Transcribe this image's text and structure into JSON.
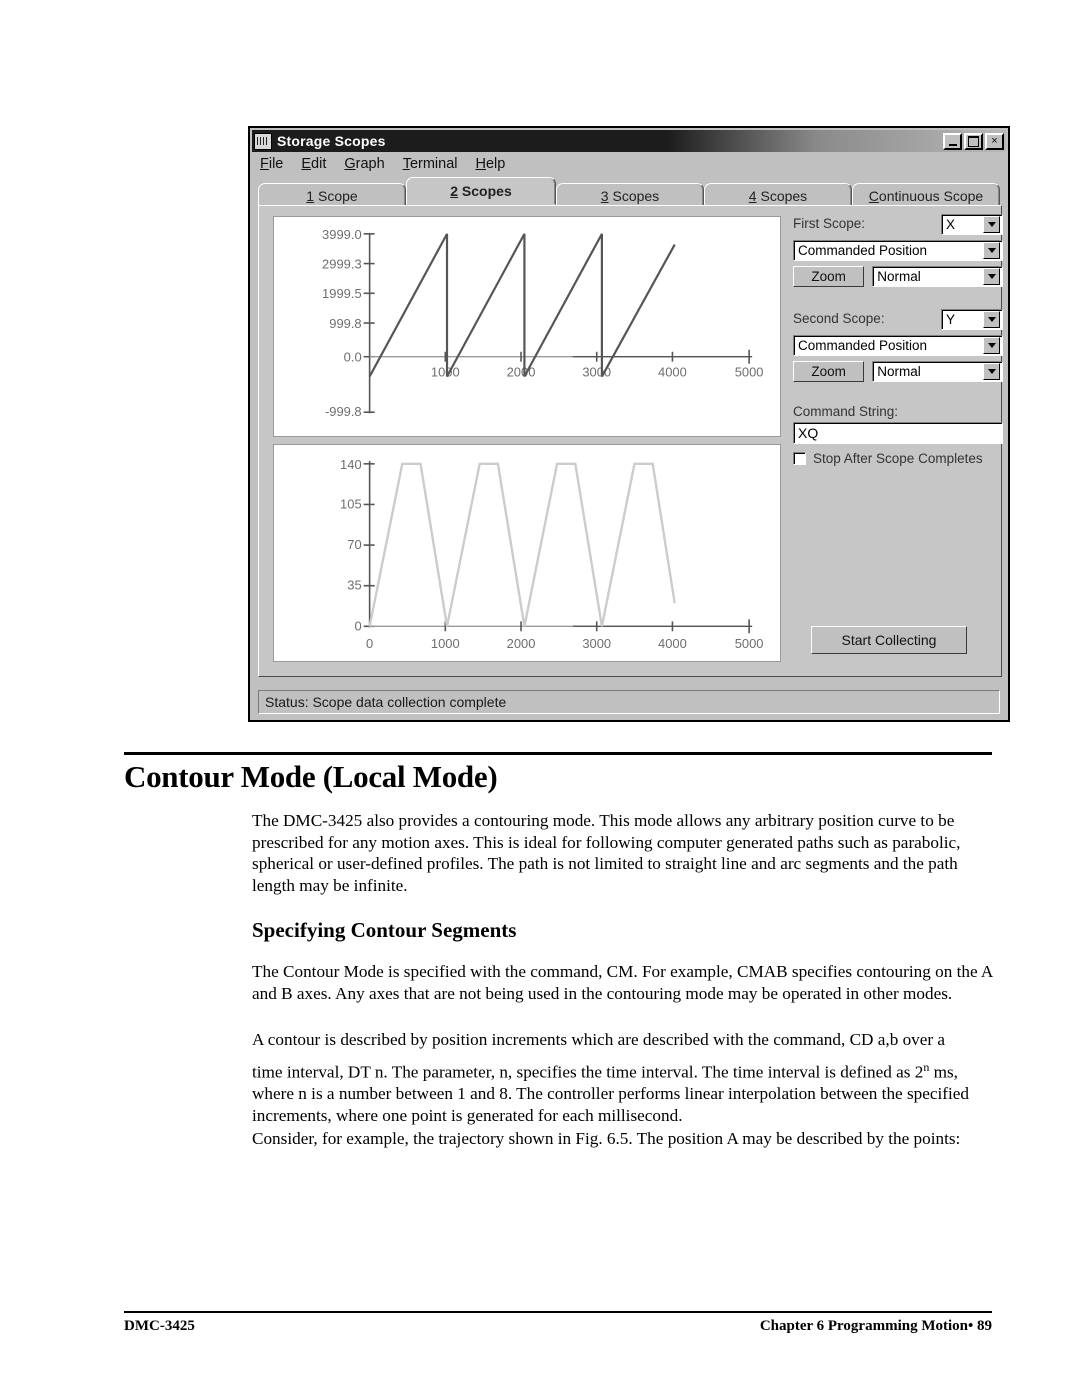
{
  "window": {
    "title": "Storage Scopes",
    "icon": "app-scope-icon",
    "buttons": {
      "minimize": "minimize-icon",
      "maximize": "maximize-icon",
      "close": "×"
    },
    "menu": [
      {
        "label": "File",
        "accel": "F"
      },
      {
        "label": "Edit",
        "accel": "E"
      },
      {
        "label": "Graph",
        "accel": "G"
      },
      {
        "label": "Terminal",
        "accel": "T"
      },
      {
        "label": "Help",
        "accel": "H"
      }
    ],
    "tabs": [
      {
        "label": "1 Scope",
        "accel": "1",
        "active": false
      },
      {
        "label": "2 Scopes",
        "accel": "2",
        "active": true
      },
      {
        "label": "3 Scopes",
        "accel": "3",
        "active": false
      },
      {
        "label": "4 Scopes",
        "accel": "4",
        "active": false
      },
      {
        "label": "Continuous Scope",
        "accel": "C",
        "active": false
      }
    ],
    "status": "Status: Scope data collection complete"
  },
  "controls": {
    "first_scope_label": "First Scope:",
    "first_scope_axis": "X",
    "first_scope_source": "Commanded Position",
    "first_zoom_label": "Zoom",
    "first_scale_mode": "Normal",
    "second_scope_label": "Second Scope:",
    "second_scope_axis": "Y",
    "second_scope_source": "Commanded Position",
    "second_zoom_label": "Zoom",
    "second_scale_mode": "Normal",
    "command_string_label": "Command String:",
    "command_string_value": "XQ",
    "stop_after_label": "Stop After Scope Completes",
    "stop_after_checked": false,
    "start_collecting_label": "Start Collecting"
  },
  "chart_data": [
    {
      "type": "line",
      "title": "",
      "name": "first-scope-plot",
      "xlabel": "",
      "ylabel": "",
      "grid": false,
      "legend": "none",
      "line_color": "#555555",
      "xlim": [
        0,
        5000
      ],
      "ylim": [
        -999.8,
        3999.0
      ],
      "xticks": [
        0,
        1000,
        2000,
        3000,
        4000,
        5000
      ],
      "xtick_labels": [
        "",
        "1000",
        "2000",
        "3000",
        "4000",
        "5000"
      ],
      "yticks": [
        -999.8,
        0.0,
        999.8,
        1999.5,
        2999.3,
        3999.0
      ],
      "ytick_labels": [
        "-999.8",
        "0.0",
        "999.8",
        "1999.5",
        "2999.3",
        "3999.0"
      ],
      "series": [
        {
          "name": "Commanded Position X",
          "waveform": "sawtooth",
          "period": 1020,
          "amplitude": 3999.0,
          "x_start": 0,
          "x_end": 4020,
          "points": [
            [
              0,
              0
            ],
            [
              1020,
              3999
            ],
            [
              1020,
              0
            ],
            [
              2040,
              3999
            ],
            [
              2040,
              0
            ],
            [
              3060,
              3999
            ],
            [
              3060,
              0
            ],
            [
              4020,
              3700
            ]
          ]
        }
      ]
    },
    {
      "type": "line",
      "title": "",
      "name": "second-scope-plot",
      "xlabel": "",
      "ylabel": "",
      "grid": false,
      "legend": "none",
      "line_color": "#cccccc",
      "xlim": [
        0,
        5000
      ],
      "ylim": [
        0,
        140
      ],
      "xticks": [
        0,
        1000,
        2000,
        3000,
        4000,
        5000
      ],
      "xtick_labels": [
        "0",
        "1000",
        "2000",
        "3000",
        "4000",
        "5000"
      ],
      "yticks": [
        0,
        35,
        70,
        105,
        140
      ],
      "ytick_labels": [
        "0",
        "35",
        "70",
        "105",
        "140"
      ],
      "series": [
        {
          "name": "Commanded Position Y",
          "waveform": "trapezoid",
          "period": 1020,
          "amplitude": 140,
          "x_start": 0,
          "x_end": 4020,
          "points": [
            [
              0,
              0
            ],
            [
              430,
              140
            ],
            [
              670,
              140
            ],
            [
              1020,
              0
            ],
            [
              1450,
              140
            ],
            [
              1690,
              140
            ],
            [
              2040,
              0
            ],
            [
              2470,
              140
            ],
            [
              2710,
              140
            ],
            [
              3060,
              0
            ],
            [
              3490,
              140
            ],
            [
              3730,
              140
            ],
            [
              4020,
              20
            ]
          ]
        }
      ]
    }
  ],
  "document": {
    "heading": "Contour Mode (Local Mode)",
    "subheading": "Specifying Contour Segments",
    "paragraph_1": "The DMC-3425 also provides a contouring mode.  This mode allows any arbitrary position curve to be prescribed for any motion axes.  This is ideal for following computer generated paths such as parabolic, spherical or user-defined profiles.  The path is not limited to straight line and arc segments and the path length may be infinite.",
    "paragraph_2": "The Contour Mode is specified with the command, CM.  For example, CMAB specifies contouring on the A and B axes.  Any axes that are not being used in the contouring mode may be operated in other modes.",
    "paragraph_3": "A contour is described by position increments which are described with the command, CD a,b over a",
    "paragraph_4_pre": "time interval, DT n.  The parameter, n, specifies the time interval.  The time interval is defined as 2",
    "paragraph_4_sup": "n",
    "paragraph_4_post": " ms, where n is a number between 1 and 8.  The controller performs linear interpolation between the specified increments, where one point is generated for each millisecond.",
    "paragraph_5": "Consider, for example, the trajectory shown in Fig. 6.5.  The position A may be described by the points:",
    "footer_left": "DMC-3425",
    "footer_right": "Chapter 6  Programming Motion•  89"
  }
}
